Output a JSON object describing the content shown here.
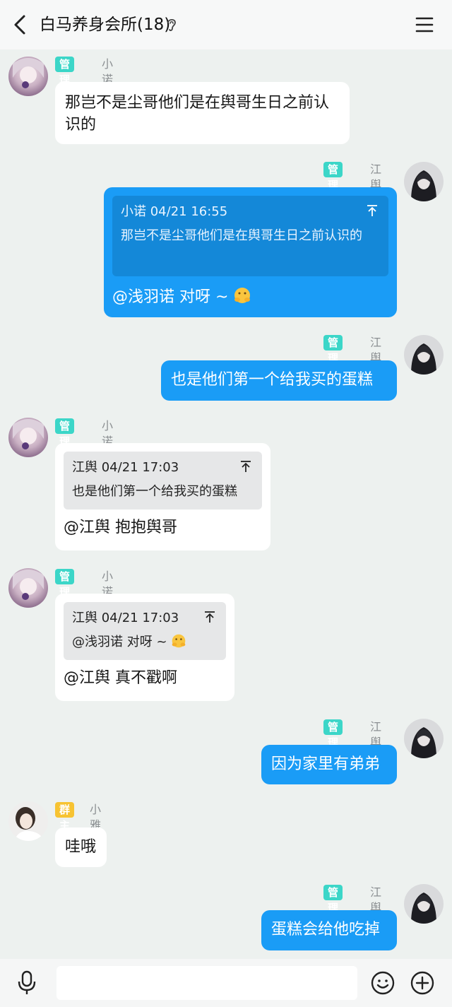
{
  "header": {
    "title": "白马养身会所(18)"
  },
  "messages": [
    {
      "side": "left",
      "badge": "管理员",
      "nick": "小诺",
      "text": "那岂不是尘哥他们是在舆哥生日之前认识的"
    },
    {
      "side": "right",
      "badge": "管理员",
      "nick": "江舆",
      "quote": {
        "head": "小诺 04/21 16:55",
        "text": "那岂不是尘哥他们是在舆哥生日之前认识的"
      },
      "reply": "@浅羽诺 对呀 ~"
    },
    {
      "side": "right",
      "badge": "管理员",
      "nick": "江舆",
      "text": "也是他们第一个给我买的蛋糕"
    },
    {
      "side": "left",
      "badge": "管理员",
      "nick": "小诺",
      "quote": {
        "head": "江舆 04/21 17:03",
        "text": "也是他们第一个给我买的蛋糕"
      },
      "reply": "@江舆 抱抱舆哥"
    },
    {
      "side": "left",
      "badge": "管理员",
      "nick": "小诺",
      "quote": {
        "head": "江舆 04/21 17:03",
        "text": "@浅羽诺 对呀 ~"
      },
      "reply": "@江舆 真不戳啊"
    },
    {
      "side": "right",
      "badge": "管理员",
      "nick": "江舆",
      "text": "因为家里有弟弟"
    },
    {
      "side": "left",
      "badge": "群主",
      "nick": "小雅",
      "text": "哇哦"
    },
    {
      "side": "right",
      "badge": "管理员",
      "nick": "江舆",
      "text": "蛋糕会给他吃掉"
    }
  ],
  "input": {
    "placeholder": ""
  },
  "colors": {
    "background": "#edf1ef",
    "self_bubble": "#1a9cf6",
    "other_bubble": "#ffffff",
    "admin_badge": "#3cd6c8",
    "owner_badge": "#f7c332"
  },
  "icons": [
    "back-arrow-icon",
    "ear-icon",
    "menu-icon",
    "reply-jump-icon",
    "hug-emoji-icon",
    "mic-icon",
    "emoji-icon",
    "plus-icon"
  ]
}
